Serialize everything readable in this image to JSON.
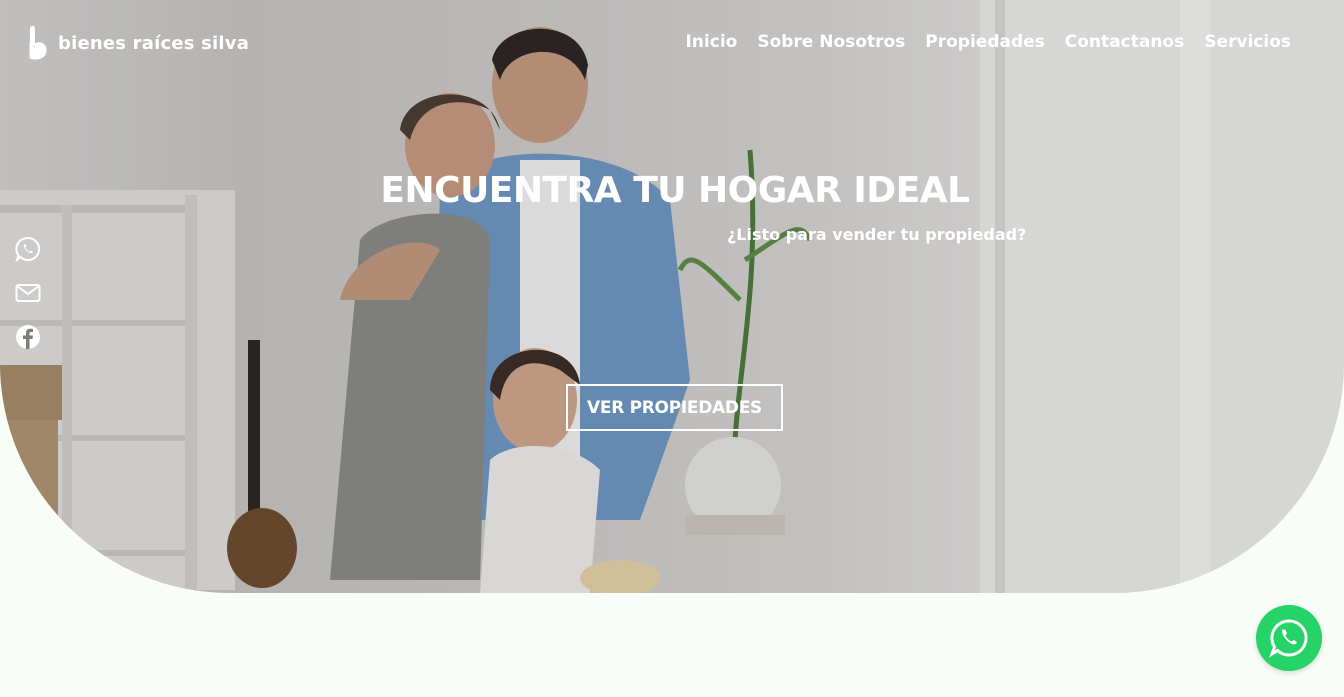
{
  "brand": {
    "name": "bienes raíces silva",
    "icon": "b-logo-icon"
  },
  "nav": {
    "items": [
      {
        "label": "Inicio"
      },
      {
        "label": "Sobre Nosotros"
      },
      {
        "label": "Propiedades"
      },
      {
        "label": "Contactanos"
      },
      {
        "label": "Servicios"
      }
    ]
  },
  "hero": {
    "title": "ENCUENTRA TU HOGAR IDEAL",
    "subtitle": "¿Listo para vender tu propiedad?",
    "cta_label": "VER PROPIEDADES",
    "image": "family-in-new-home-photo"
  },
  "social": {
    "icons": [
      "whatsapp-icon",
      "email-icon",
      "facebook-icon"
    ]
  },
  "floating": {
    "icon": "whatsapp-icon",
    "color": "#25d366"
  },
  "colors": {
    "page_bg": "#f9fdf8",
    "text_on_hero": "#ffffff"
  }
}
